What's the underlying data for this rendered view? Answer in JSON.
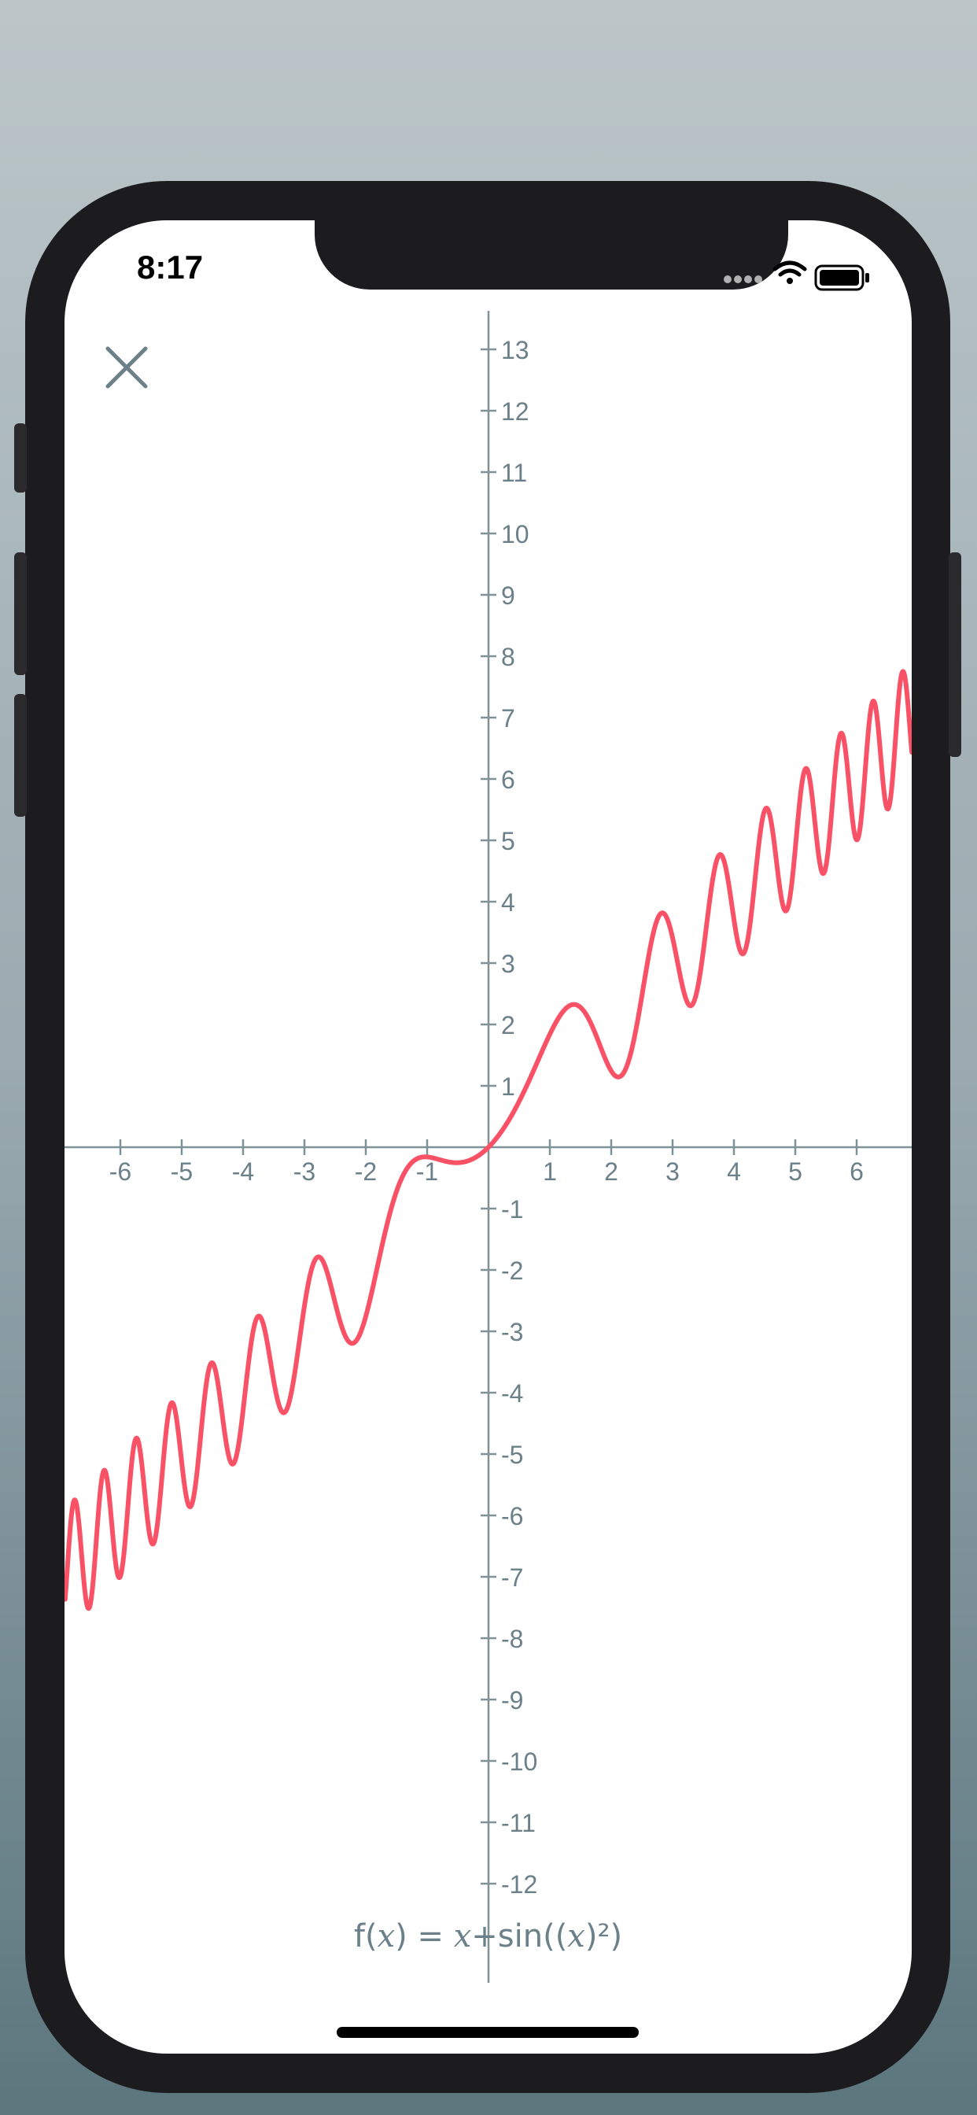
{
  "status_bar": {
    "time": "8:17",
    "icons": [
      "signal-dots-icon",
      "wifi-icon",
      "battery-icon"
    ]
  },
  "toolbar": {
    "close_icon": "close-icon"
  },
  "colors": {
    "curve": "#f95166",
    "axis": "#7e9298",
    "label": "#6b8088",
    "background": "#ffffff"
  },
  "chart_data": {
    "type": "line",
    "title": "f(x) = x+sin((x)²)",
    "formula": {
      "prefix": "f(",
      "var1": "x",
      "middle": ") = ",
      "var2": "x",
      "suffix1": "+sin((",
      "var3": "x",
      "suffix2": ")²)"
    },
    "function": "x+sin(x^2)",
    "xlim": [
      -6.9,
      6.9
    ],
    "ylim": [
      -13.5,
      13.5
    ],
    "x_ticks": [
      -6,
      -5,
      -4,
      -3,
      -2,
      -1,
      1,
      2,
      3,
      4,
      5,
      6
    ],
    "y_ticks": [
      -12,
      -11,
      -10,
      -9,
      -8,
      -7,
      -6,
      -5,
      -4,
      -3,
      -2,
      -1,
      1,
      2,
      3,
      4,
      5,
      6,
      7,
      8,
      9,
      10,
      11,
      12,
      13
    ],
    "x_tick_labels": [
      "-6",
      "-5",
      "-4",
      "-3",
      "-2",
      "-1",
      "1",
      "2",
      "3",
      "4",
      "5",
      "6"
    ],
    "y_tick_labels": [
      "-12",
      "-11",
      "-10",
      "-9",
      "-8",
      "-7",
      "-6",
      "-5",
      "-4",
      "-3",
      "-2",
      "-1",
      "1",
      "2",
      "3",
      "4",
      "5",
      "6",
      "7",
      "8",
      "9",
      "10",
      "11",
      "12",
      "13"
    ],
    "series": [
      {
        "samples_x": [
          -6.9,
          -6.5,
          -6.0,
          -5.5,
          -5.0,
          -4.5,
          -4.0,
          -3.5,
          -3.0,
          -2.5,
          -2.0,
          -1.5,
          -1.0,
          -0.5,
          0,
          0.5,
          1.0,
          1.5,
          2.0,
          2.5,
          3.0,
          3.5,
          4.0,
          4.5,
          5.0,
          5.5,
          6.0,
          6.5,
          6.9
        ],
        "samples_y": [
          -7.09,
          -7.35,
          -6.99,
          -5.04,
          -5.13,
          -3.62,
          -4.29,
          -3.83,
          -2.59,
          -2.53,
          -2.76,
          -0.72,
          -0.16,
          -0.25,
          0,
          0.75,
          1.84,
          2.28,
          1.24,
          2.47,
          3.41,
          3.19,
          3.71,
          5.47,
          4.87,
          6.31,
          5.01,
          6.51,
          7.91
        ]
      }
    ],
    "grid": false
  }
}
